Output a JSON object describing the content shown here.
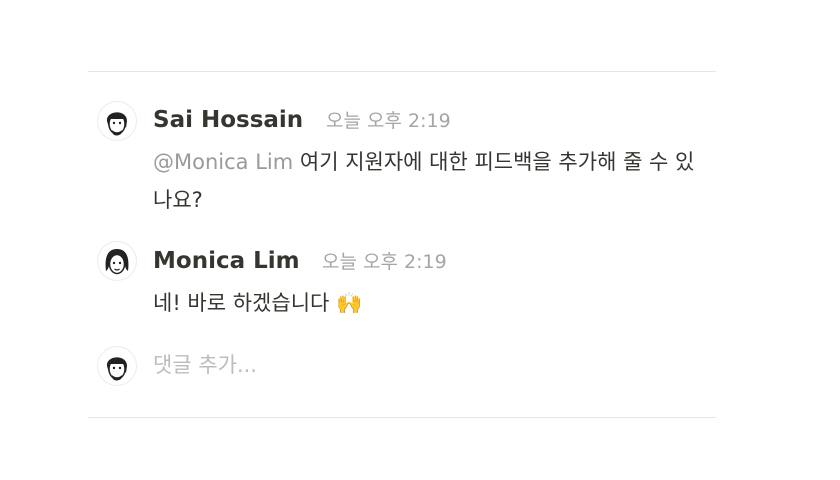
{
  "comments": [
    {
      "author": "Sai Hossain",
      "time": "오늘 오후 2:19",
      "mention": "@Monica Lim",
      "text": "여기 지원자에 대한 피드백을 추가해 줄 수 있나요?"
    },
    {
      "author": "Monica Lim",
      "time": "오늘 오후 2:19",
      "text": "네! 바로 하겠습니다",
      "emoji": "🙌"
    }
  ],
  "composer": {
    "placeholder": "댓글 추가..."
  },
  "icons": [
    "sai-hossain-avatar",
    "monica-lim-avatar",
    "current-user-avatar",
    "raising-hands-emoji"
  ]
}
